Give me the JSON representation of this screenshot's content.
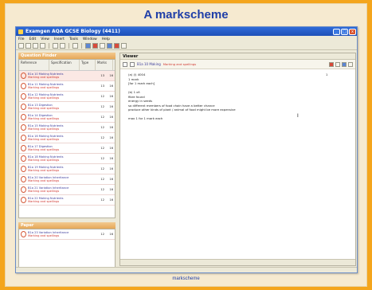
{
  "slide": {
    "title": "A markscheme",
    "caption": "markscheme"
  },
  "window": {
    "title": "Examgen AQA GCSE Biology (4411)",
    "buttons": [
      "_",
      "□",
      "x"
    ]
  },
  "menubar": [
    "File",
    "Edit",
    "View",
    "Insert",
    "Tools",
    "Window",
    "Help"
  ],
  "left_panel": {
    "header": "Question Finder",
    "columns": [
      "Reference",
      "Specification",
      "Type",
      "Marks"
    ],
    "questions": [
      {
        "text1": "B1a 10 Making Nutrients",
        "text2": "Marking and spellings",
        "n1": "13",
        "n2": "16"
      },
      {
        "text1": "B1a 11 Making Nutrients",
        "text2": "Marking and spellings",
        "n1": "13",
        "n2": "16"
      },
      {
        "text1": "B1a 12 Making Nutrients",
        "text2": "Marking and spellings",
        "n1": "12",
        "n2": "16"
      },
      {
        "text1": "B1a 13 Digestion",
        "text2": "Marking and spellings",
        "n1": "12",
        "n2": "16"
      },
      {
        "text1": "B1a 14 Digestion",
        "text2": "Marking and spellings",
        "n1": "12",
        "n2": "16"
      },
      {
        "text1": "B1a 15 Making Nutrients",
        "text2": "Marking and spellings",
        "n1": "12",
        "n2": "16"
      },
      {
        "text1": "B1a 16 Making Nutrients",
        "text2": "Marking and spellings",
        "n1": "12",
        "n2": "16"
      },
      {
        "text1": "B1a 17 Digestion",
        "text2": "Marking and spellings",
        "n1": "12",
        "n2": "16"
      },
      {
        "text1": "B1a 18 Making Nutrients",
        "text2": "Marking and spellings",
        "n1": "12",
        "n2": "16"
      },
      {
        "text1": "B1a 19 Making Nutrients",
        "text2": "Marking and spellings",
        "n1": "12",
        "n2": "16"
      },
      {
        "text1": "B1a 20 Variation Inheritance",
        "text2": "Marking and spellings",
        "n1": "12",
        "n2": "16"
      },
      {
        "text1": "B1a 21 Variation Inheritance",
        "text2": "Marking and spellings",
        "n1": "12",
        "n2": "16"
      },
      {
        "text1": "B1a 22 Making Nutrients",
        "text2": "Marking and spellings",
        "n1": "12",
        "n2": "16"
      }
    ],
    "paper_header": "Paper",
    "paper_items": [
      {
        "text1": "B1a 23 Variation Inheritance",
        "text2": "Marking and spellings",
        "n1": "12",
        "n2": "16"
      }
    ]
  },
  "viewer": {
    "header": "Viewer",
    "toolbar_label": "B1a 10 Making",
    "toolbar_sub": "Marking and spellings",
    "lines": [
      "(a)    (i)     4004",
      "        1 mark",
      "                                              [for 1 mark each]",
      "",
      "(b)    1 of:",
      "        fibre found",
      "        energy in seeds",
      "        so different members of food chain have a better chance",
      "        produce other kinds of plant / animal of food might be more expensive",
      "",
      "                    max 1 for 1 mark each"
    ],
    "side_mark": "1",
    "cursor": "I"
  },
  "colors": {
    "background": "#f4a51c",
    "title_blue": "#1f3ea8",
    "accent_red": "#d0352e"
  }
}
